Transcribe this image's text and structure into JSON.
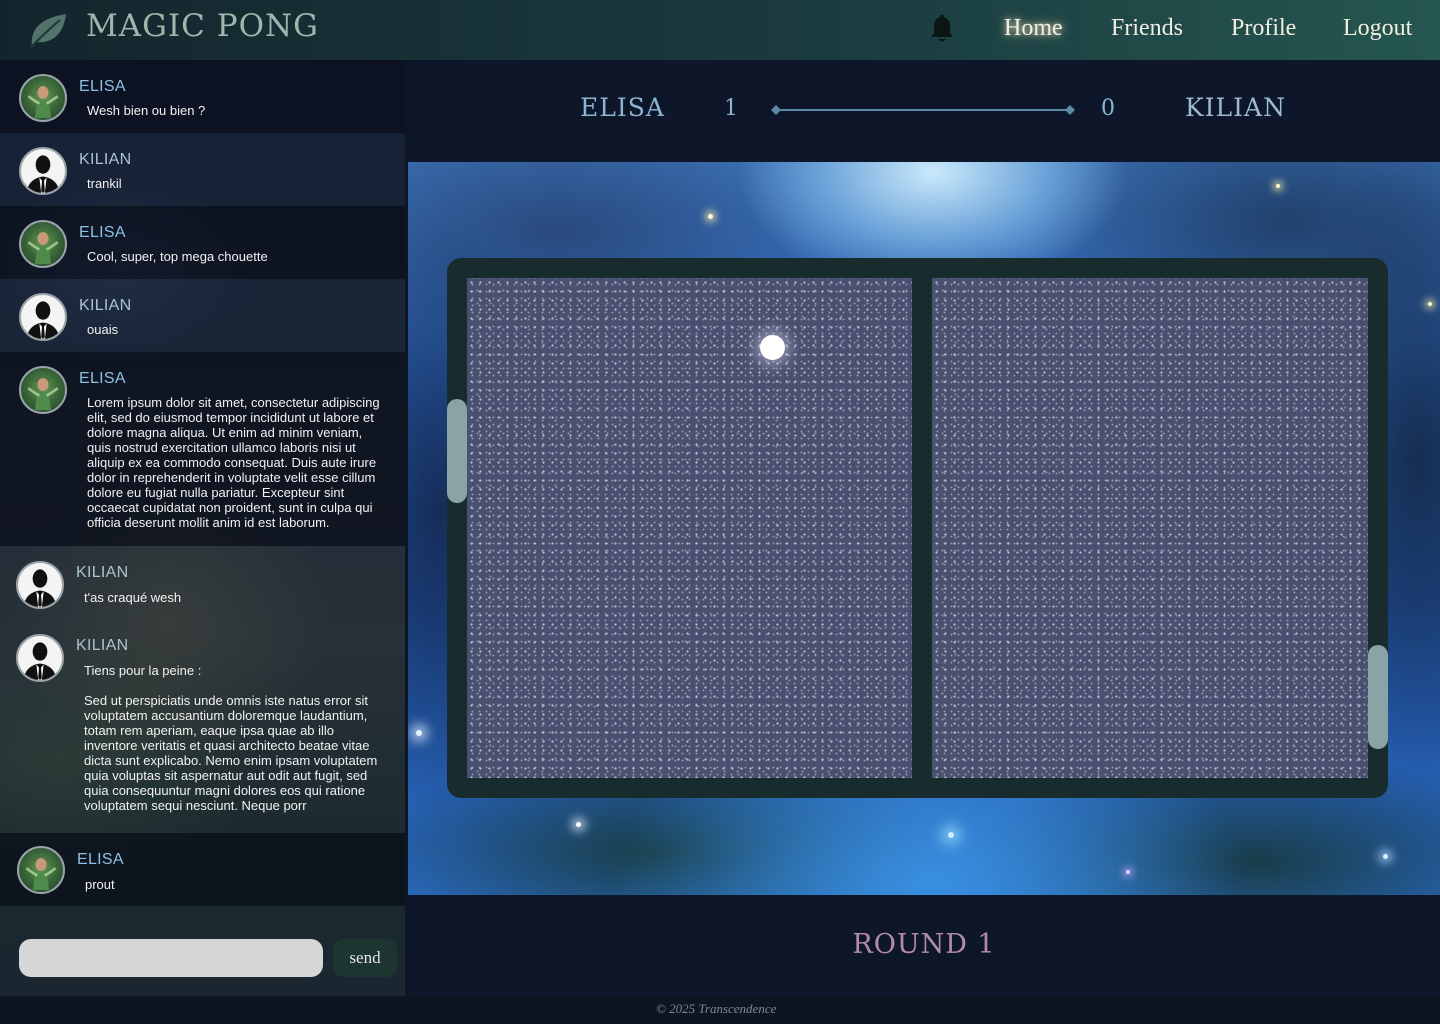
{
  "navbar": {
    "brand": "MAGIC PONG",
    "links": [
      {
        "label": "Home",
        "active": true
      },
      {
        "label": "Friends",
        "active": false
      },
      {
        "label": "Profile",
        "active": false
      },
      {
        "label": "Logout",
        "active": false
      }
    ],
    "icons": {
      "logo": "leaf-icon",
      "notifications": "bell-icon"
    }
  },
  "chat": {
    "messages": [
      {
        "author": "ELISA",
        "text": "Wesh bien ou bien ?"
      },
      {
        "author": "KILIAN",
        "text": "trankil"
      },
      {
        "author": "ELISA",
        "text": "Cool, super, top mega chouette"
      },
      {
        "author": "KILIAN",
        "text": "ouais"
      },
      {
        "author": "ELISA",
        "text": "Lorem ipsum dolor sit amet, consectetur adipiscing elit, sed do eiusmod tempor incididunt ut labore et dolore magna aliqua. Ut enim ad minim veniam, quis nostrud exercitation ullamco laboris nisi ut aliquip ex ea commodo consequat. Duis aute irure dolor in reprehenderit in voluptate velit esse cillum dolore eu fugiat nulla pariatur. Excepteur sint occaecat cupidatat non proident, sunt in culpa qui officia deserunt mollit anim id est laborum."
      },
      {
        "author": "KILIAN",
        "text": "t'as craqué wesh"
      },
      {
        "author": "KILIAN",
        "text": "Tiens pour la peine :\n\nSed ut perspiciatis unde omnis iste natus error sit voluptatem accusantium doloremque laudantium, totam rem aperiam, eaque ipsa quae ab illo inventore veritatis et quasi architecto beatae vitae dicta sunt explicabo. Nemo enim ipsam voluptatem quia voluptas sit aspernatur aut odit aut fugit, sed quia consequuntur magni dolores eos qui ratione voluptatem sequi nesciunt. Neque porr"
      },
      {
        "author": "ELISA",
        "text": "prout"
      }
    ],
    "input": {
      "value": "",
      "placeholder": ""
    },
    "send_label": "send"
  },
  "game": {
    "player1": {
      "name": "ELISA",
      "score": "1"
    },
    "player2": {
      "name": "KILIAN",
      "score": "0"
    },
    "round_label": "ROUND 1"
  },
  "footer": {
    "text": "© 2025 Transcendence"
  },
  "colors": {
    "navbar_start": "#13252c",
    "navbar_end": "#25564f",
    "score_text": "#8cb4d4",
    "round_text": "#b48ba9",
    "field": "#4a5170",
    "board": "#182b2d",
    "paddle": "#8aa3a6"
  }
}
